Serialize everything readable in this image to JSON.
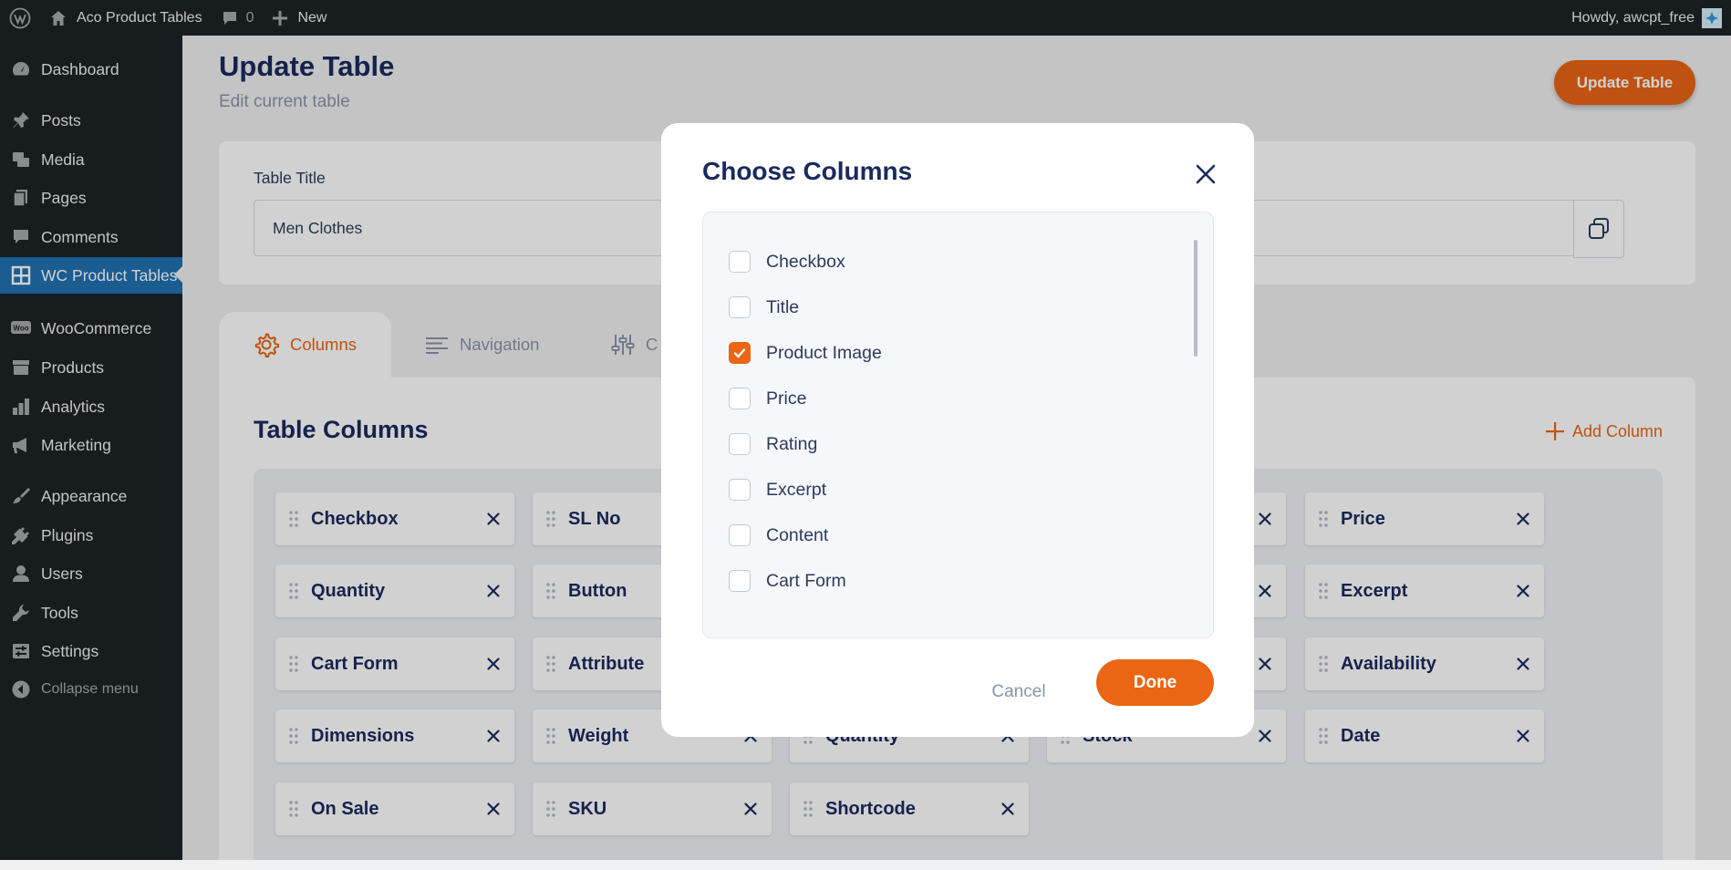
{
  "adminbar": {
    "site_name": "Aco Product Tables",
    "comments_count": "0",
    "new_label": "New",
    "howdy": "Howdy, awcpt_free"
  },
  "sidebar": {
    "items": [
      {
        "label": "Dashboard",
        "icon": "dashboard-icon"
      },
      {
        "label": "Posts",
        "icon": "pin-icon"
      },
      {
        "label": "Media",
        "icon": "media-icon"
      },
      {
        "label": "Pages",
        "icon": "pages-icon"
      },
      {
        "label": "Comments",
        "icon": "comment-icon"
      },
      {
        "label": "WC Product Tables",
        "icon": "grid-icon",
        "active": true
      },
      {
        "label": "WooCommerce",
        "icon": "woo-icon"
      },
      {
        "label": "Products",
        "icon": "archive-icon"
      },
      {
        "label": "Analytics",
        "icon": "bar-chart-icon"
      },
      {
        "label": "Marketing",
        "icon": "megaphone-icon"
      },
      {
        "label": "Appearance",
        "icon": "brush-icon"
      },
      {
        "label": "Plugins",
        "icon": "plug-icon"
      },
      {
        "label": "Users",
        "icon": "user-icon"
      },
      {
        "label": "Tools",
        "icon": "wrench-icon"
      },
      {
        "label": "Settings",
        "icon": "settings-icon"
      }
    ],
    "collapse_label": "Collapse menu"
  },
  "header": {
    "title": "Update Table",
    "subtitle": "Edit current table",
    "update_button": "Update Table"
  },
  "table_title": {
    "label": "Table Title",
    "value": "Men Clothes"
  },
  "tabs": [
    {
      "label": "Columns",
      "active": true
    },
    {
      "label": "Navigation"
    },
    {
      "label": "C"
    }
  ],
  "columns_section": {
    "title": "Table Columns",
    "add_column": "Add Column",
    "chips": [
      "Checkbox",
      "SL No",
      "",
      "",
      "Price",
      "Quantity",
      "Button",
      "",
      "",
      "Excerpt",
      "Cart Form",
      "Attribute",
      "",
      "",
      "Availability",
      "Dimensions",
      "Weight",
      "Quantity",
      "Stock",
      "Date",
      "On Sale",
      "SKU",
      "Shortcode"
    ]
  },
  "modal": {
    "title": "Choose Columns",
    "options": [
      {
        "label": "Checkbox",
        "checked": false
      },
      {
        "label": "Title",
        "checked": false
      },
      {
        "label": "Product Image",
        "checked": true
      },
      {
        "label": "Price",
        "checked": false
      },
      {
        "label": "Rating",
        "checked": false
      },
      {
        "label": "Excerpt",
        "checked": false
      },
      {
        "label": "Content",
        "checked": false
      },
      {
        "label": "Cart Form",
        "checked": false
      }
    ],
    "cancel": "Cancel",
    "done": "Done"
  },
  "colors": {
    "accent": "#ea6514",
    "admin_dark": "#1d2327",
    "admin_active": "#2271b1",
    "heading": "#1a2a5e"
  }
}
